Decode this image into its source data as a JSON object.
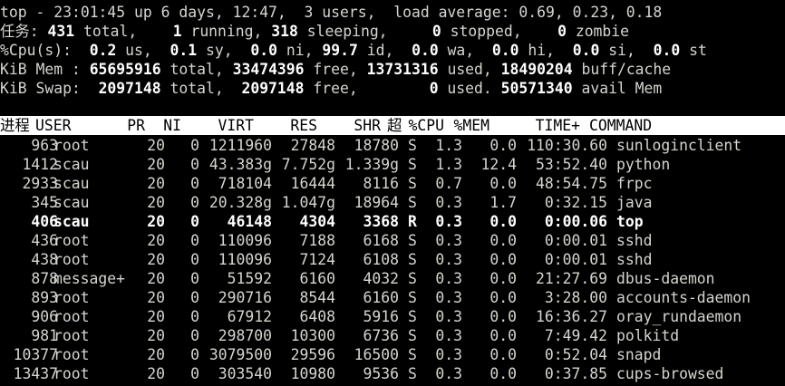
{
  "summary": {
    "top_label": "top - ",
    "clock": "23:01:45",
    "uptime_text": " up 6 days, 12:47,  ",
    "users": "3 users",
    "load_label": ",  load average: ",
    "load": "0.69, 0.23, 0.18",
    "tasks_label": "任务:",
    "tasks_total": "431",
    "tasks_total_label": " total,",
    "tasks_running": "1",
    "tasks_running_label": " running,",
    "tasks_sleeping": "318",
    "tasks_sleeping_label": " sleeping,",
    "tasks_stopped": "0",
    "tasks_stopped_label": " stopped,",
    "tasks_zombie": "0",
    "tasks_zombie_label": " zombie",
    "cpu_label": "%Cpu(s):",
    "cpu_us": "0.2",
    "cpu_us_label": " us,",
    "cpu_sy": "0.1",
    "cpu_sy_label": " sy,",
    "cpu_ni": "0.0",
    "cpu_ni_label": " ni,",
    "cpu_id": "99.7",
    "cpu_id_label": " id,",
    "cpu_wa": "0.0",
    "cpu_wa_label": " wa,",
    "cpu_hi": "0.0",
    "cpu_hi_label": " hi,",
    "cpu_si": "0.0",
    "cpu_si_label": " si,",
    "cpu_st": "0.0",
    "cpu_st_label": " st",
    "mem_label": "KiB Mem : ",
    "mem_total": "65695916",
    "mem_total_label": " total, ",
    "mem_free": "33474396",
    "mem_free_label": " free, ",
    "mem_used": "13731316",
    "mem_used_label": " used, ",
    "mem_cache": "18490204",
    "mem_cache_label": " buff/cache",
    "swap_label": "KiB Swap:  ",
    "swap_total": "2097148",
    "swap_total_label": " total,  ",
    "swap_free": "2097148",
    "swap_free_label": " free,        ",
    "swap_used": "0",
    "swap_used_label": " used. ",
    "swap_avail": "50571340",
    "swap_avail_label": " avail Mem"
  },
  "columns": {
    "pid": "进程",
    "user": "USER",
    "pr": "PR",
    "ni": "NI",
    "virt": "VIRT",
    "res": "RES",
    "shr": "SHR",
    "s": "超",
    "cpu": "%CPU",
    "mem": "%MEM",
    "time": "TIME+",
    "command": "COMMAND"
  },
  "processes": [
    {
      "pid": "963",
      "user": "root",
      "pr": "20",
      "ni": "0",
      "virt": "1211960",
      "res": "27848",
      "shr": "18780",
      "s": "S",
      "cpu": "1.3",
      "mem": "0.0",
      "time": "110:30.60",
      "command": "sunloginclient"
    },
    {
      "pid": "1412",
      "user": "scau",
      "pr": "20",
      "ni": "0",
      "virt": "43.383g",
      "res": "7.752g",
      "shr": "1.339g",
      "s": "S",
      "cpu": "1.3",
      "mem": "12.4",
      "time": "53:52.40",
      "command": "python"
    },
    {
      "pid": "2933",
      "user": "scau",
      "pr": "20",
      "ni": "0",
      "virt": "718104",
      "res": "16444",
      "shr": "8116",
      "s": "S",
      "cpu": "0.7",
      "mem": "0.0",
      "time": "48:54.75",
      "command": "frpc"
    },
    {
      "pid": "345",
      "user": "scau",
      "pr": "20",
      "ni": "0",
      "virt": "20.328g",
      "res": "1.047g",
      "shr": "18964",
      "s": "S",
      "cpu": "0.3",
      "mem": "1.7",
      "time": "0:32.15",
      "command": "java"
    },
    {
      "pid": "406",
      "user": "scau",
      "pr": "20",
      "ni": "0",
      "virt": "46148",
      "res": "4304",
      "shr": "3368",
      "s": "R",
      "cpu": "0.3",
      "mem": "0.0",
      "time": "0:00.06",
      "command": "top"
    },
    {
      "pid": "436",
      "user": "root",
      "pr": "20",
      "ni": "0",
      "virt": "110096",
      "res": "7188",
      "shr": "6168",
      "s": "S",
      "cpu": "0.3",
      "mem": "0.0",
      "time": "0:00.01",
      "command": "sshd"
    },
    {
      "pid": "438",
      "user": "root",
      "pr": "20",
      "ni": "0",
      "virt": "110096",
      "res": "7124",
      "shr": "6108",
      "s": "S",
      "cpu": "0.3",
      "mem": "0.0",
      "time": "0:00.01",
      "command": "sshd"
    },
    {
      "pid": "878",
      "user": "message+",
      "pr": "20",
      "ni": "0",
      "virt": "51592",
      "res": "6160",
      "shr": "4032",
      "s": "S",
      "cpu": "0.3",
      "mem": "0.0",
      "time": "21:27.69",
      "command": "dbus-daemon"
    },
    {
      "pid": "893",
      "user": "root",
      "pr": "20",
      "ni": "0",
      "virt": "290716",
      "res": "8544",
      "shr": "6160",
      "s": "S",
      "cpu": "0.3",
      "mem": "0.0",
      "time": "3:28.00",
      "command": "accounts-daemon"
    },
    {
      "pid": "906",
      "user": "root",
      "pr": "20",
      "ni": "0",
      "virt": "67912",
      "res": "6408",
      "shr": "5916",
      "s": "S",
      "cpu": "0.3",
      "mem": "0.0",
      "time": "16:36.27",
      "command": "oray_rundaemon"
    },
    {
      "pid": "981",
      "user": "root",
      "pr": "20",
      "ni": "0",
      "virt": "298700",
      "res": "10300",
      "shr": "6736",
      "s": "S",
      "cpu": "0.3",
      "mem": "0.0",
      "time": "7:49.42",
      "command": "polkitd"
    },
    {
      "pid": "10377",
      "user": "root",
      "pr": "20",
      "ni": "0",
      "virt": "3079500",
      "res": "29596",
      "shr": "16500",
      "s": "S",
      "cpu": "0.3",
      "mem": "0.0",
      "time": "0:52.04",
      "command": "snapd"
    },
    {
      "pid": "13437",
      "user": "root",
      "pr": "20",
      "ni": "0",
      "virt": "303540",
      "res": "10980",
      "shr": "9536",
      "s": "S",
      "cpu": "0.3",
      "mem": "0.0",
      "time": "0:37.85",
      "command": "cups-browsed"
    }
  ],
  "highlighted_row": 4,
  "colors": {
    "background": "#000000",
    "text": "#d3d7cf",
    "bold_text": "#ffffff",
    "header_bar_bg": "#ffffff",
    "header_bar_text": "#000000"
  }
}
